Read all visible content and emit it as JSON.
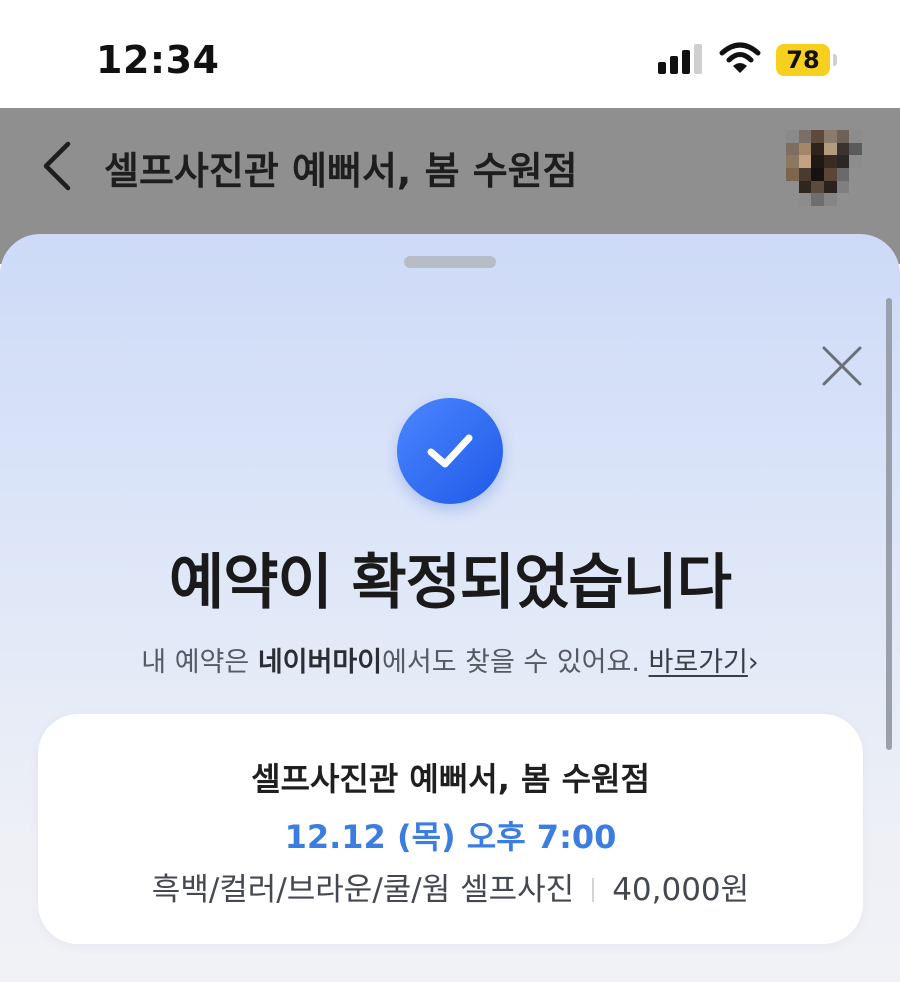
{
  "status_bar": {
    "time": "12:34",
    "battery_level": "78",
    "signal_bars_active": 3,
    "signal_bars_total": 4,
    "battery_color": "#f7cf1d"
  },
  "header": {
    "title": "셀프사진관 예뻐서, 봄 수원점",
    "back_icon": "chevron-left-icon",
    "avatar": "pixelated-avatar"
  },
  "sheet": {
    "close_icon": "close-icon",
    "check_icon": "check-circle-icon",
    "accent_color": "#2f6af2",
    "title": "예약이 확정되었습니다",
    "info": {
      "prefix": "내 예약은 ",
      "emphasis": "네이버마이",
      "suffix": "에서도 찾을 수 있어요.",
      "link_label": "바로가기",
      "link_chevron": "›"
    }
  },
  "reservation": {
    "store_name": "셀프사진관 예뻐서, 봄 수원점",
    "datetime": "12.12 (목) 오후 7:00",
    "datetime_color": "#3c7de0",
    "product": "흑백/컬러/브라운/쿨/웜 셀프사진",
    "price": "40,000원"
  }
}
